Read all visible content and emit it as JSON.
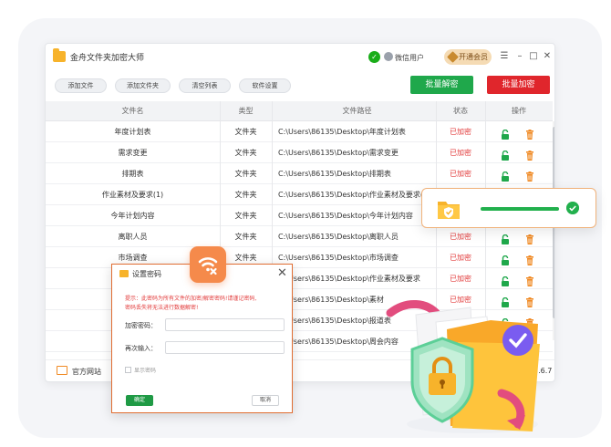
{
  "app": {
    "title": "金舟文件夹加密大师",
    "user_label": "微信用户",
    "vip_label": "开通会员",
    "window_controls": [
      "☰",
      "–",
      "□",
      "✕"
    ],
    "icons": [
      "folder-app-icon",
      "wechat-icon",
      "user-icon",
      "vip-diamond-icon"
    ]
  },
  "toolbar": {
    "add_file": "添加文件",
    "add_folder": "添加文件夹",
    "clear_list": "清空列表",
    "settings": "软件设置",
    "batch_decrypt": "批量解密",
    "batch_encrypt": "批量加密"
  },
  "colors": {
    "decrypt_green": "#22b04d",
    "encrypt_red": "#e23b3b",
    "accent_orange": "#f58a4b"
  },
  "table": {
    "headers": {
      "name": "文件名",
      "type": "类型",
      "path": "文件路径",
      "status": "状态",
      "op": "操作"
    },
    "rows": [
      {
        "name": "年度计划表",
        "type": "文件夹",
        "path": "C:\\Users\\86135\\Desktop\\年度计划表",
        "status": "已加密"
      },
      {
        "name": "需求变更",
        "type": "文件夹",
        "path": "C:\\Users\\86135\\Desktop\\需求变更",
        "status": "已加密"
      },
      {
        "name": "排期表",
        "type": "文件夹",
        "path": "C:\\Users\\86135\\Desktop\\排期表",
        "status": "已加密"
      },
      {
        "name": "作业素材及要求(1)",
        "type": "文件夹",
        "path": "C:\\Users\\86135\\Desktop\\作业素材及要求(1)",
        "status": "已加密"
      },
      {
        "name": "今年计划内容",
        "type": "文件夹",
        "path": "C:\\Users\\86135\\Desktop\\今年计划内容",
        "status": "已加密"
      },
      {
        "name": "离职人员",
        "type": "文件夹",
        "path": "C:\\Users\\86135\\Desktop\\离职人员",
        "status": "已加密"
      },
      {
        "name": "市场调查",
        "type": "文件夹",
        "path": "C:\\Users\\86135\\Desktop\\市场调查",
        "status": "已加密"
      },
      {
        "name": "作",
        "type": "文件夹",
        "path": "C:\\Users\\86135\\Desktop\\作业素材及要求",
        "status": "已加密"
      },
      {
        "name": "",
        "type": "",
        "path": "C:\\Users\\86135\\Desktop\\素材",
        "status": "已加密"
      },
      {
        "name": "",
        "type": "",
        "path": "C:\\Users\\86135\\Desktop\\报道表",
        "status": "已加密"
      },
      {
        "name": "",
        "type": "",
        "path": "C:\\Users\\86135\\Desktop\\周会内容",
        "status": "已加密"
      }
    ]
  },
  "statusbar": {
    "website": "官方网站",
    "version": "v3.6.7"
  },
  "dialog": {
    "title": "设置密码",
    "tip_line1": "提示：此密码为所有文件的加密/解密密码!请谨记密码,",
    "tip_line2": "密码丢失将无法进行数据解密!",
    "password_label": "加密密码：",
    "confirm_label": "再次输入：",
    "show_password": "显示密码",
    "ok": "确定",
    "cancel": "取消"
  },
  "progress_card": {
    "progress": 1.0
  }
}
